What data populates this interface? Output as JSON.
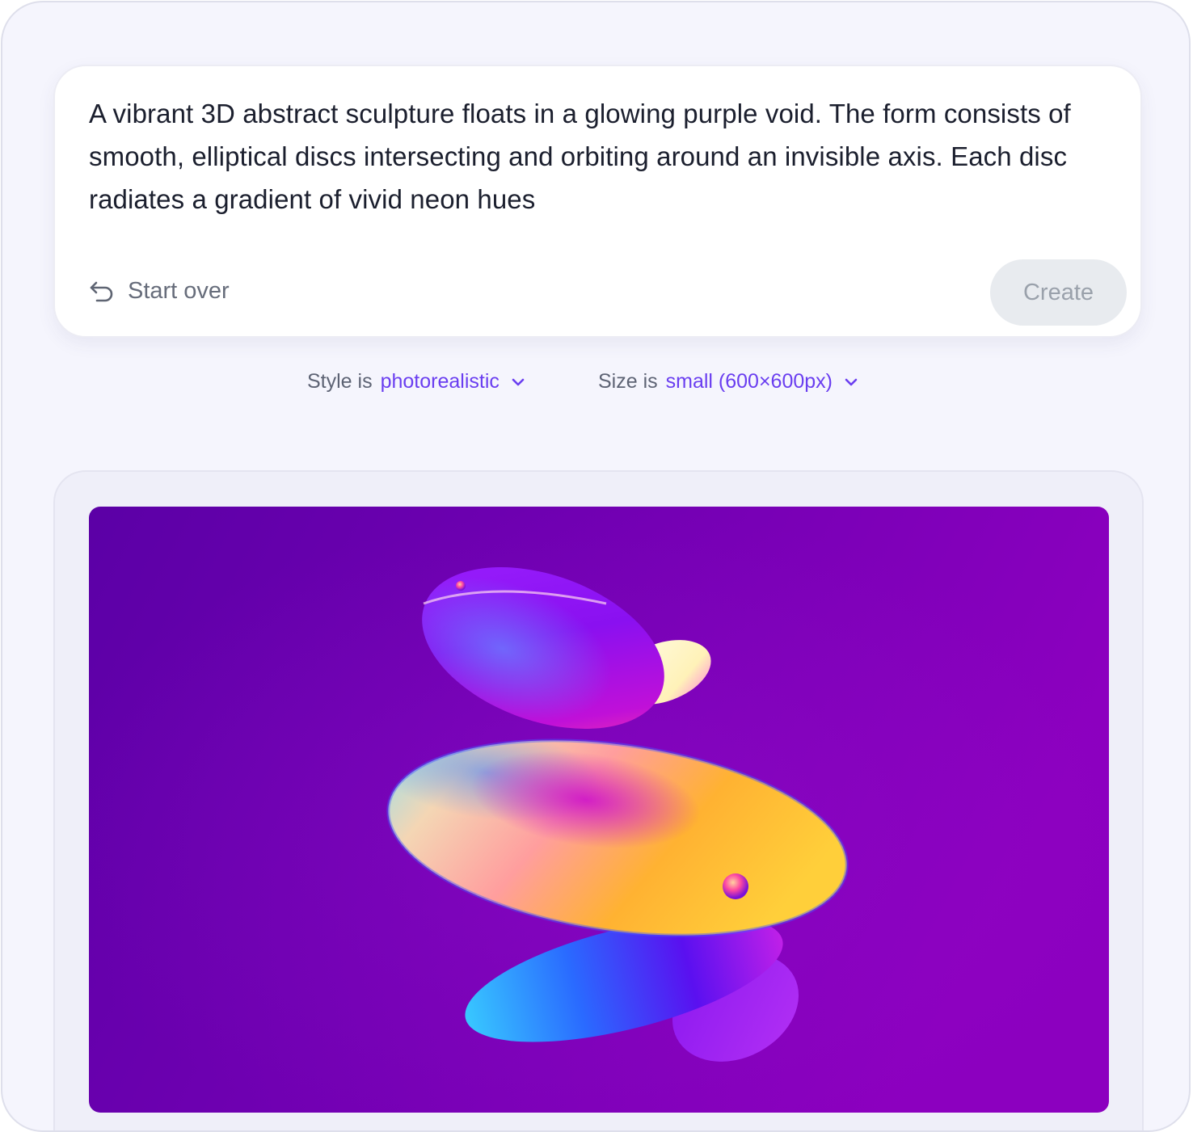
{
  "prompt": {
    "text": "A vibrant 3D abstract sculpture floats in a glowing purple void. The form consists of smooth, elliptical discs intersecting and orbiting around an invisible axis. Each disc radiates a gradient of vivid neon hues"
  },
  "actions": {
    "start_over_label": "Start over",
    "start_over_icon": "undo-arrow-icon",
    "create_label": "Create"
  },
  "options": {
    "style": {
      "prefix": "Style is",
      "value": "photorealistic",
      "icon": "chevron-down-icon"
    },
    "size": {
      "prefix": "Size is",
      "value": "small (600×600px)",
      "icon": "chevron-down-icon"
    }
  },
  "result": {
    "image": "generated-image"
  },
  "colors": {
    "page_bg": "#f5f5fd",
    "accent": "#6a3ef0",
    "text_primary": "#1b1f2e",
    "text_muted": "#676d7b",
    "button_disabled_bg": "#e8ebef",
    "button_disabled_text": "#9aa1ab",
    "image_bg": "#7a00b8"
  }
}
